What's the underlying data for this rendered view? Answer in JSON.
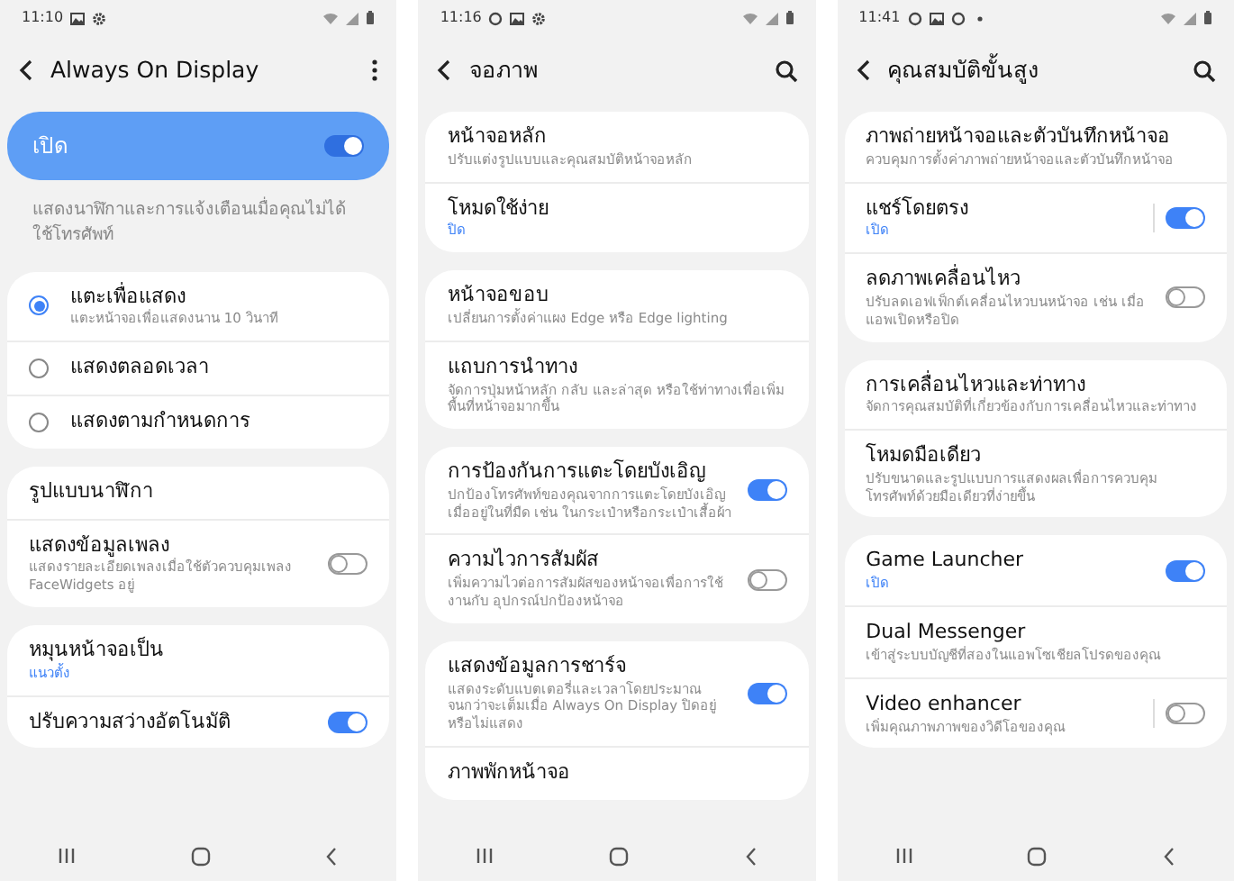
{
  "phones": [
    {
      "status_bar": {
        "time": "11:10",
        "notification_icons": [
          {
            "kind": "image"
          },
          {
            "kind": "gear"
          }
        ]
      },
      "header": {
        "title": "Always On Display",
        "actions": [
          {
            "kind": "more"
          }
        ]
      },
      "banner": {
        "label": "เปิด",
        "on": true
      },
      "description": "แสดงนาฬิกาและการแจ้งเตือนเมื่อคุณไม่ได้ใช้โทรศัพท์",
      "groups": [
        {
          "items": [
            {
              "kind": "radio",
              "title": "แตะเพื่อแสดง",
              "subtitle": "แตะหน้าจอเพื่อแสดงนาน 10 วินาที",
              "selected": true
            },
            {
              "kind": "radio",
              "title": "แสดงตลอดเวลา",
              "selected": false
            },
            {
              "kind": "radio",
              "title": "แสดงตามกำหนดการ",
              "selected": false
            }
          ]
        },
        {
          "items": [
            {
              "kind": "plain",
              "title": "รูปแบบนาฬิกา"
            },
            {
              "kind": "toggle",
              "title": "แสดงข้อมูลเพลง",
              "subtitle": "แสดงรายละเอียดเพลงเมื่อใช้ตัวควบคุมเพลง FaceWidgets อยู่",
              "on": false
            }
          ]
        },
        {
          "items": [
            {
              "kind": "plain",
              "title": "หมุนหน้าจอเป็น",
              "value": "แนวตั้ง"
            },
            {
              "kind": "toggle",
              "title": "ปรับความสว่างอัตโนมัติ",
              "on": true
            }
          ]
        }
      ]
    },
    {
      "status_bar": {
        "time": "11:16",
        "notification_icons": [
          {
            "kind": "circle"
          },
          {
            "kind": "image"
          },
          {
            "kind": "gear"
          }
        ]
      },
      "header": {
        "title": "จอภาพ",
        "actions": [
          {
            "kind": "search"
          }
        ]
      },
      "groups": [
        {
          "items": [
            {
              "kind": "plain",
              "title": "หน้าจอหลัก",
              "subtitle": "ปรับแต่งรูปแบบและคุณสมบัติหน้าจอหลัก"
            },
            {
              "kind": "plain",
              "title": "โหมดใช้ง่าย",
              "value": "ปิด"
            }
          ]
        },
        {
          "items": [
            {
              "kind": "plain",
              "title": "หน้าจอขอบ",
              "subtitle": "เปลี่ยนการตั้งค่าแผง Edge หรือ Edge lighting"
            },
            {
              "kind": "plain",
              "title": "แถบการนำทาง",
              "subtitle": "จัดการปุ่มหน้าหลัก กลับ และล่าสุด หรือใช้ท่าทางเพื่อเพิ่มพื้นที่หน้าจอมากขึ้น"
            }
          ]
        },
        {
          "items": [
            {
              "kind": "toggle",
              "title": "การป้องกันการแตะโดยบังเอิญ",
              "subtitle": "ปกป้องโทรศัพท์ของคุณจากการแตะโดยบังเอิญเมื่ออยู่ในที่มืด เช่น ในกระเป๋าหรือกระเป๋าเสื้อผ้า",
              "on": true
            },
            {
              "kind": "toggle",
              "title": "ความไวการสัมผัส",
              "subtitle": "เพิ่มความไวต่อการสัมผัสของหน้าจอเพื่อการใช้งานกับ อุปกรณ์ปกป้องหน้าจอ",
              "on": false
            }
          ]
        },
        {
          "items": [
            {
              "kind": "toggle",
              "title": "แสดงข้อมูลการชาร์จ",
              "subtitle": "แสดงระดับแบตเตอรี่และเวลาโดยประมาณจนกว่าจะเต็มเมื่อ Always On Display ปิดอยู่หรือไม่แสดง",
              "on": true
            },
            {
              "kind": "plain",
              "title": "ภาพพักหน้าจอ"
            }
          ]
        }
      ]
    },
    {
      "status_bar": {
        "time": "11:41",
        "notification_icons": [
          {
            "kind": "circle"
          },
          {
            "kind": "image"
          },
          {
            "kind": "circle"
          },
          {
            "kind": "dot"
          }
        ]
      },
      "header": {
        "title": "คุณสมบัติขั้นสูง",
        "actions": [
          {
            "kind": "search"
          }
        ]
      },
      "groups": [
        {
          "items": [
            {
              "kind": "plain",
              "title": "ภาพถ่ายหน้าจอและตัวบันทึกหน้าจอ",
              "subtitle": "ควบคุมการตั้งค่าภาพถ่ายหน้าจอและตัวบันทึกหน้าจอ"
            },
            {
              "kind": "toggle",
              "title": "แชร์โดยตรง",
              "value": "เปิด",
              "on": true,
              "split": true
            },
            {
              "kind": "toggle",
              "title": "ลดภาพเคลื่อนไหว",
              "subtitle": "ปรับลดเอฟเฟ็กต์เคลื่อนไหวบนหน้าจอ เช่น เมื่อแอพเปิดหรือปิด",
              "on": false
            }
          ]
        },
        {
          "items": [
            {
              "kind": "plain",
              "title": "การเคลื่อนไหวและท่าทาง",
              "subtitle": "จัดการคุณสมบัติที่เกี่ยวข้องกับการเคลื่อนไหวและท่าทาง"
            },
            {
              "kind": "plain",
              "title": "โหมดมือเดียว",
              "subtitle": "ปรับขนาดและรูปแบบการแสดงผลเพื่อการควบคุมโทรศัพท์ด้วยมือเดียวที่ง่ายขึ้น"
            }
          ]
        },
        {
          "items": [
            {
              "kind": "toggle",
              "title": "Game Launcher",
              "value": "เปิด",
              "on": true
            },
            {
              "kind": "plain",
              "title": "Dual Messenger",
              "subtitle": "เข้าสู่ระบบบัญชีที่สองในแอพโซเชียลโปรดของคุณ"
            },
            {
              "kind": "toggle",
              "title": "Video enhancer",
              "subtitle": "เพิ่มคุณภาพภาพของวิดีโอของคุณ",
              "on": false,
              "split": true
            }
          ]
        }
      ]
    }
  ]
}
